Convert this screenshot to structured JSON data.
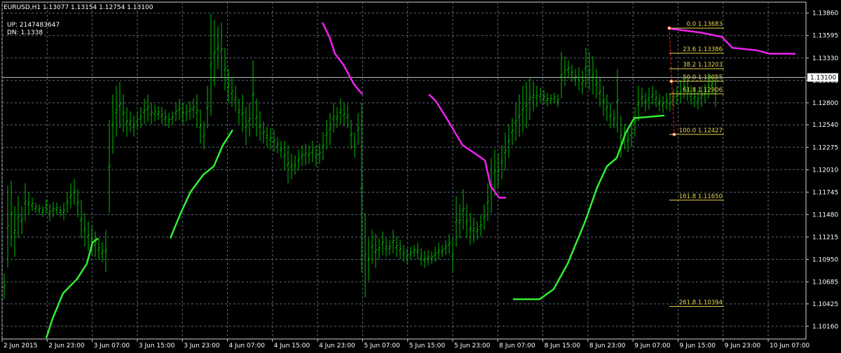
{
  "header": {
    "symbol_line": "EURUSD,H1  1.13077 1.13154 1.12754 1.13100"
  },
  "indicator": {
    "up_line": "UP: 2147483647",
    "dn_line": "DN: 1.1338"
  },
  "chart_data": {
    "type": "candlestick",
    "symbol": "EURUSD",
    "timeframe": "H1",
    "ylim": [
      1.1001,
      1.1399
    ],
    "current_price": "1.13100",
    "y_ticks": [
      "1.13860",
      "1.13595",
      "1.13330",
      "1.13065",
      "1.12800",
      "1.12540",
      "1.12275",
      "1.12010",
      "1.11745",
      "1.11480",
      "1.11215",
      "1.10950",
      "1.10685",
      "1.10425",
      "1.10160"
    ],
    "x_ticks": [
      "2 Jun 2015",
      "2 Jun 23:00",
      "3 Jun 07:00",
      "3 Jun 15:00",
      "3 Jun 23:00",
      "4 Jun 07:00",
      "4 Jun 15:00",
      "4 Jun 23:00",
      "5 Jun 07:00",
      "5 Jun 15:00",
      "5 Jun 23:00",
      "8 Jun 07:00",
      "8 Jun 15:00",
      "8 Jun 23:00",
      "9 Jun 07:00",
      "9 Jun 15:00",
      "9 Jun 23:00",
      "10 Jun 07:00"
    ],
    "bar_spacing_bars": 5,
    "price_bars_low_high": [
      [
        1.1048,
        1.1078
      ],
      [
        1.1085,
        1.1182
      ],
      [
        1.111,
        1.1188
      ],
      [
        1.1098,
        1.1158
      ],
      [
        1.112,
        1.117
      ],
      [
        1.1125,
        1.1158
      ],
      [
        1.114,
        1.1185
      ],
      [
        1.1148,
        1.1175
      ],
      [
        1.1152,
        1.1168
      ],
      [
        1.115,
        1.1162
      ],
      [
        1.1148,
        1.116
      ],
      [
        1.1145,
        1.1158
      ],
      [
        1.115,
        1.1166
      ],
      [
        1.114,
        1.116
      ],
      [
        1.1145,
        1.1163
      ],
      [
        1.1148,
        1.1162
      ],
      [
        1.1145,
        1.1158
      ],
      [
        1.1142,
        1.1162
      ],
      [
        1.115,
        1.1175
      ],
      [
        1.1155,
        1.1185
      ],
      [
        1.116,
        1.119
      ],
      [
        1.1145,
        1.1178
      ],
      [
        1.112,
        1.1165
      ],
      [
        1.111,
        1.115
      ],
      [
        1.1105,
        1.114
      ],
      [
        1.11,
        1.1135
      ],
      [
        1.1098,
        1.1128
      ],
      [
        1.1095,
        1.112
      ],
      [
        1.1092,
        1.1115
      ],
      [
        1.108,
        1.113
      ],
      [
        1.115,
        1.126
      ],
      [
        1.122,
        1.129
      ],
      [
        1.124,
        1.13
      ],
      [
        1.125,
        1.1305
      ],
      [
        1.1245,
        1.129
      ],
      [
        1.124,
        1.1275
      ],
      [
        1.1245,
        1.127
      ],
      [
        1.124,
        1.1265
      ],
      [
        1.1248,
        1.127
      ],
      [
        1.125,
        1.1275
      ],
      [
        1.1255,
        1.1285
      ],
      [
        1.1258,
        1.129
      ],
      [
        1.1255,
        1.128
      ],
      [
        1.1258,
        1.1278
      ],
      [
        1.126,
        1.1276
      ],
      [
        1.1255,
        1.1275
      ],
      [
        1.1252,
        1.1272
      ],
      [
        1.125,
        1.1268
      ],
      [
        1.1254,
        1.127
      ],
      [
        1.1258,
        1.128
      ],
      [
        1.126,
        1.1285
      ],
      [
        1.1255,
        1.128
      ],
      [
        1.1258,
        1.1278
      ],
      [
        1.126,
        1.1282
      ],
      [
        1.1262,
        1.1285
      ],
      [
        1.125,
        1.129
      ],
      [
        1.1232,
        1.1272
      ],
      [
        1.1225,
        1.1258
      ],
      [
        1.125,
        1.13
      ],
      [
        1.1265,
        1.1385
      ],
      [
        1.13,
        1.1378
      ],
      [
        1.132,
        1.137
      ],
      [
        1.131,
        1.1375
      ],
      [
        1.1295,
        1.1345
      ],
      [
        1.128,
        1.132
      ],
      [
        1.1275,
        1.131
      ],
      [
        1.127,
        1.13
      ],
      [
        1.1255,
        1.1285
      ],
      [
        1.1245,
        1.129
      ],
      [
        1.123,
        1.1275
      ],
      [
        1.124,
        1.128
      ],
      [
        1.125,
        1.133
      ],
      [
        1.124,
        1.1285
      ],
      [
        1.1235,
        1.127
      ],
      [
        1.1232,
        1.1258
      ],
      [
        1.1228,
        1.1252
      ],
      [
        1.1225,
        1.125
      ],
      [
        1.1222,
        1.1248
      ],
      [
        1.122,
        1.124
      ],
      [
        1.1215,
        1.1235
      ],
      [
        1.12,
        1.1235
      ],
      [
        1.1185,
        1.123
      ],
      [
        1.119,
        1.122
      ],
      [
        1.1195,
        1.1218
      ],
      [
        1.12,
        1.1225
      ],
      [
        1.1205,
        1.123
      ],
      [
        1.1206,
        1.1232
      ],
      [
        1.1208,
        1.123
      ],
      [
        1.121,
        1.1235
      ],
      [
        1.1205,
        1.123
      ],
      [
        1.1208,
        1.1232
      ],
      [
        1.1212,
        1.1245
      ],
      [
        1.1225,
        1.126
      ],
      [
        1.123,
        1.1268
      ],
      [
        1.1245,
        1.128
      ],
      [
        1.125,
        1.1275
      ],
      [
        1.1255,
        1.1285
      ],
      [
        1.1252,
        1.128
      ],
      [
        1.125,
        1.1278
      ],
      [
        1.1225,
        1.126
      ],
      [
        1.1215,
        1.1245
      ],
      [
        1.123,
        1.1268
      ],
      [
        1.108,
        1.128
      ],
      [
        1.105,
        1.115
      ],
      [
        1.107,
        1.112
      ],
      [
        1.109,
        1.113
      ],
      [
        1.1085,
        1.1125
      ],
      [
        1.1095,
        1.112
      ],
      [
        1.11,
        1.1128
      ],
      [
        1.1098,
        1.112
      ],
      [
        1.11,
        1.1118
      ],
      [
        1.1102,
        1.113
      ],
      [
        1.1098,
        1.1122
      ],
      [
        1.1095,
        1.1118
      ],
      [
        1.1092,
        1.1112
      ],
      [
        1.109,
        1.1108
      ],
      [
        1.1095,
        1.111
      ],
      [
        1.1098,
        1.1112
      ],
      [
        1.1095,
        1.1115
      ],
      [
        1.1088,
        1.1108
      ],
      [
        1.1085,
        1.1105
      ],
      [
        1.1088,
        1.1106
      ],
      [
        1.109,
        1.1104
      ],
      [
        1.1092,
        1.111
      ],
      [
        1.1095,
        1.1115
      ],
      [
        1.1098,
        1.1112
      ],
      [
        1.11,
        1.1118
      ],
      [
        1.1102,
        1.1125
      ],
      [
        1.108,
        1.112
      ],
      [
        1.111,
        1.117
      ],
      [
        1.112,
        1.116
      ],
      [
        1.113,
        1.1178
      ],
      [
        1.112,
        1.116
      ],
      [
        1.1112,
        1.115
      ],
      [
        1.1115,
        1.1145
      ],
      [
        1.1118,
        1.114
      ],
      [
        1.1122,
        1.1148
      ],
      [
        1.113,
        1.116
      ],
      [
        1.114,
        1.1185
      ],
      [
        1.115,
        1.1215
      ],
      [
        1.117,
        1.1225
      ],
      [
        1.118,
        1.122
      ],
      [
        1.119,
        1.123
      ],
      [
        1.12,
        1.1245
      ],
      [
        1.1215,
        1.1255
      ],
      [
        1.123,
        1.1262
      ],
      [
        1.1235,
        1.128
      ],
      [
        1.124,
        1.129
      ],
      [
        1.1245,
        1.13
      ],
      [
        1.125,
        1.1305
      ],
      [
        1.126,
        1.131
      ],
      [
        1.127,
        1.1305
      ],
      [
        1.1275,
        1.13
      ],
      [
        1.128,
        1.1298
      ],
      [
        1.1278,
        1.1295
      ],
      [
        1.1276,
        1.1292
      ],
      [
        1.1278,
        1.129
      ],
      [
        1.128,
        1.1292
      ],
      [
        1.1275,
        1.129
      ],
      [
        1.1285,
        1.134
      ],
      [
        1.13,
        1.1335
      ],
      [
        1.131,
        1.133
      ],
      [
        1.1305,
        1.1325
      ],
      [
        1.13,
        1.132
      ],
      [
        1.1295,
        1.1322
      ],
      [
        1.129,
        1.1318
      ],
      [
        1.1298,
        1.1345
      ],
      [
        1.1295,
        1.134
      ],
      [
        1.129,
        1.1335
      ],
      [
        1.1285,
        1.132
      ],
      [
        1.1275,
        1.131
      ],
      [
        1.1265,
        1.13
      ],
      [
        1.1258,
        1.129
      ],
      [
        1.125,
        1.128
      ],
      [
        1.125,
        1.1272
      ],
      [
        1.1245,
        1.132
      ],
      [
        1.1215,
        1.1265
      ],
      [
        1.1225,
        1.1255
      ],
      [
        1.1222,
        1.125
      ],
      [
        1.1228,
        1.1258
      ],
      [
        1.124,
        1.1275
      ],
      [
        1.1258,
        1.13
      ],
      [
        1.1275,
        1.1298
      ],
      [
        1.127,
        1.1292
      ],
      [
        1.1272,
        1.1298
      ],
      [
        1.1278,
        1.13
      ],
      [
        1.1275,
        1.1295
      ],
      [
        1.127,
        1.129
      ],
      [
        1.1268,
        1.1288
      ],
      [
        1.1272,
        1.1292
      ],
      [
        1.127,
        1.129
      ],
      [
        1.1275,
        1.1296
      ],
      [
        1.1278,
        1.13
      ],
      [
        1.128,
        1.1305
      ],
      [
        1.1285,
        1.131
      ],
      [
        1.1282,
        1.1308
      ],
      [
        1.1278,
        1.13
      ],
      [
        1.1275,
        1.1298
      ],
      [
        1.1272,
        1.1295
      ],
      [
        1.1275,
        1.13
      ],
      [
        1.128,
        1.1302
      ],
      [
        1.1285,
        1.1315
      ],
      [
        1.129,
        1.1312
      ],
      [
        1.1275,
        1.131
      ]
    ],
    "green_line": [
      [
        66,
        1.1002
      ],
      [
        75,
        1.1025
      ],
      [
        90,
        1.1055
      ],
      [
        110,
        1.1072
      ],
      [
        124,
        1.109
      ],
      [
        132,
        1.1115
      ],
      [
        140,
        1.112
      ],
      [
        243,
        1.112
      ],
      [
        258,
        1.115
      ],
      [
        272,
        1.1175
      ],
      [
        290,
        1.1195
      ],
      [
        305,
        1.1205
      ],
      [
        318,
        1.123
      ],
      [
        332,
        1.1248
      ],
      [
        450,
        1.1248
      ],
      [
        732,
        1.1048
      ],
      [
        770,
        1.1048
      ],
      [
        790,
        1.106
      ],
      [
        810,
        1.109
      ],
      [
        835,
        1.114
      ],
      [
        852,
        1.118
      ],
      [
        866,
        1.1205
      ],
      [
        880,
        1.1215
      ],
      [
        893,
        1.1245
      ],
      [
        905,
        1.1262
      ],
      [
        948,
        1.1265
      ]
    ],
    "magenta_line": [
      [
        460,
        1.1375
      ],
      [
        470,
        1.1358
      ],
      [
        478,
        1.1338
      ],
      [
        490,
        1.1325
      ],
      [
        505,
        1.1302
      ],
      [
        517,
        1.129
      ],
      [
        612,
        1.129
      ],
      [
        622,
        1.1282
      ],
      [
        640,
        1.1258
      ],
      [
        660,
        1.123
      ],
      [
        678,
        1.122
      ],
      [
        692,
        1.1212
      ],
      [
        700,
        1.1182
      ],
      [
        712,
        1.1168
      ],
      [
        722,
        1.1168
      ],
      [
        953,
        1.1368
      ],
      [
        1000,
        1.1363
      ],
      [
        1030,
        1.1358
      ],
      [
        1045,
        1.1345
      ],
      [
        1080,
        1.1342
      ],
      [
        1098,
        1.1338
      ],
      [
        1135,
        1.1338
      ]
    ],
    "fibonacci": {
      "levels": [
        {
          "label": "0.0  1.13683",
          "price": 1.13683
        },
        {
          "label": "23.6  1.13386",
          "price": 1.13386
        },
        {
          "label": "38.2  1.13203",
          "price": 1.13203
        },
        {
          "label": "50.0  1.13055",
          "price": 1.13055
        },
        {
          "label": "61.8  1.12906",
          "price": 1.12906
        },
        {
          "label": "100.0  1.12427",
          "price": 1.12427
        },
        {
          "label": "161.8  1.11650",
          "price": 1.1165
        },
        {
          "label": "261.8  1.10394",
          "price": 1.10394
        }
      ]
    },
    "colors": {
      "background": "#000000",
      "grid": "#5a6a78",
      "bars": "#00c000",
      "green_line": "#33ee33",
      "magenta_line": "#ee22ee",
      "fib_levels": "#e8d44d",
      "fib_trendline": "#dd2222",
      "axis_text": "#ffffff",
      "current_price_box": "#ffffff"
    }
  }
}
